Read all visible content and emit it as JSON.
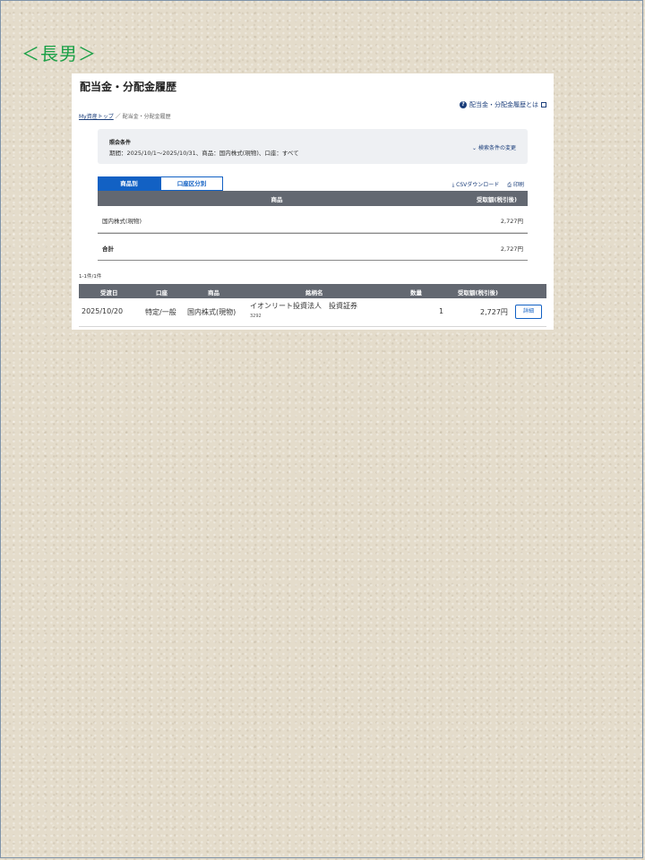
{
  "slide_label": "＜長男＞",
  "page_title": "配当金・分配金履歴",
  "help_link": "配当金・分配金履歴とは",
  "breadcrumb": {
    "home": "My資産トップ",
    "separator": "／",
    "current": "配当金・分配金履歴"
  },
  "conditions": {
    "title": "照会条件",
    "text": "期間：2025/10/1～2025/10/31、商品：国内株式(現物)、口座：すべて",
    "change_link": "検索条件の変更"
  },
  "tabs": [
    {
      "label": "商品別",
      "active": true
    },
    {
      "label": "口座区分別",
      "active": false
    }
  ],
  "actions": {
    "csv": "CSVダウンロード",
    "print": "印刷"
  },
  "summary_table": {
    "headers": [
      "商品",
      "受取額(税引後)"
    ],
    "rows": [
      {
        "product": "国内株式(現物)",
        "amount": "2,727円"
      }
    ],
    "total": {
      "label": "合計",
      "amount": "2,727円"
    }
  },
  "result_count": "1-1件/1件",
  "detail_table": {
    "headers": [
      "受渡日",
      "口座",
      "商品",
      "銘柄名",
      "数量",
      "受取額(税引後)"
    ],
    "rows": [
      {
        "date": "2025/10/20",
        "account": "特定/一般",
        "product": "国内株式(現物)",
        "name": "イオンリート投資法人　投資証券",
        "code": "3292",
        "quantity": "1",
        "amount": "2,727円",
        "detail_button": "詳細"
      }
    ]
  },
  "colors": {
    "accent": "#1261c4",
    "header_bg": "#636871",
    "label_green": "#1aa046",
    "background": "#e4dccb"
  }
}
